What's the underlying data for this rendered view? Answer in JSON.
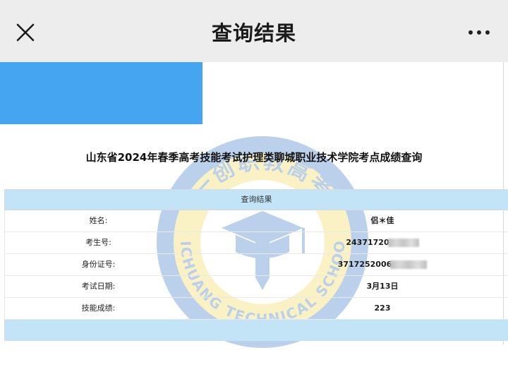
{
  "header": {
    "title": "查询结果",
    "close_icon": "close-icon",
    "more_icon": "more-dots-icon"
  },
  "page_heading": "山东省2024年春季高考技能考试护理类聊城职业技术学院考点成绩查询",
  "watermark": {
    "top_text": "一创职教高考",
    "bottom_text": "YICHUANG TECHNICAL SCHOOL"
  },
  "table": {
    "header": "查询结果",
    "rows": [
      {
        "label": "姓名:",
        "value": "侣＊佳"
      },
      {
        "label": "考生号:",
        "value": "24371720"
      },
      {
        "label": "身份证号:",
        "value": "3717252006"
      },
      {
        "label": "考试日期:",
        "value": "3月13日"
      },
      {
        "label": "技能成绩:",
        "value": "223"
      }
    ]
  },
  "colors": {
    "topbar": "#ededed",
    "blue_block": "#46a5f0",
    "table_header": "#c3e4f6"
  }
}
